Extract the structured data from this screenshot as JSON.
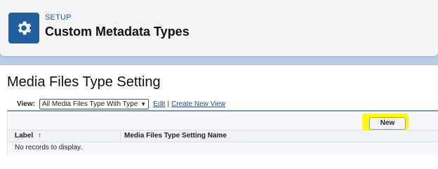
{
  "header": {
    "section": "SETUP",
    "title": "Custom Metadata Types",
    "icon": "gear-icon",
    "icon_color": "#1f5f9e"
  },
  "page": {
    "title": "Media Files Type Setting"
  },
  "view": {
    "label": "View:",
    "selected": "All Media Files Type With Type",
    "edit": "Edit",
    "separator": "|",
    "create": "Create New View"
  },
  "actions": {
    "new_label": "New"
  },
  "table": {
    "columns": [
      "Label",
      "Media Files Type Setting Name"
    ],
    "sort_indicator": "↑",
    "empty_message": "No records to display."
  }
}
